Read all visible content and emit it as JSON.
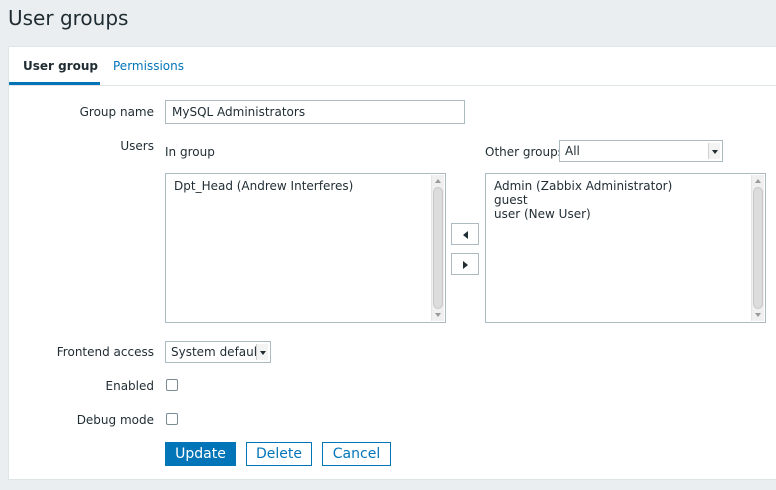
{
  "page": {
    "title": "User groups"
  },
  "tabs": [
    {
      "label": "User group",
      "active": true
    },
    {
      "label": "Permissions",
      "active": false
    }
  ],
  "form": {
    "group_name": {
      "label": "Group name",
      "value": "MySQL Administrators"
    },
    "users": {
      "label": "Users",
      "in_group_label": "In group",
      "in_group_items": [
        "Dpt_Head (Andrew Interferes)"
      ],
      "other_groups_label": "Other groups",
      "other_groups_filter": "All",
      "other_groups_items": [
        "Admin (Zabbix Administrator)",
        "guest",
        "user (New User)"
      ]
    },
    "frontend_access": {
      "label": "Frontend access",
      "value": "System default"
    },
    "enabled": {
      "label": "Enabled",
      "checked": false
    },
    "debug_mode": {
      "label": "Debug mode",
      "checked": false
    }
  },
  "buttons": {
    "update": "Update",
    "delete": "Delete",
    "cancel": "Cancel"
  },
  "colors": {
    "accent": "#0275b8",
    "background": "#ebeef0",
    "text": "#1f2c33"
  },
  "icons": {
    "move_left": "arrow-left-icon",
    "move_right": "arrow-right-icon",
    "dropdown": "chevron-down-icon"
  }
}
